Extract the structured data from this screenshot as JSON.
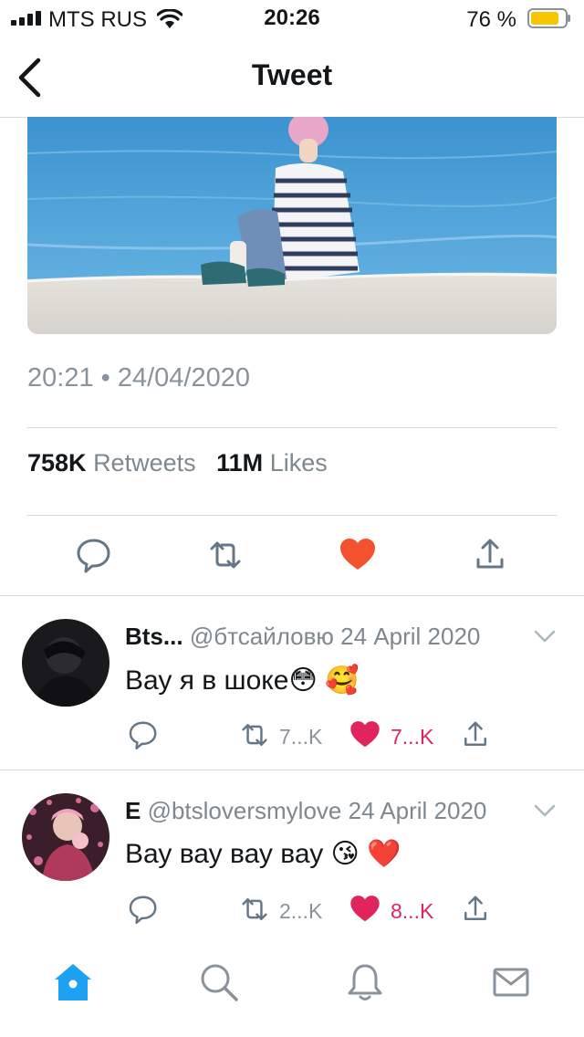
{
  "status_bar": {
    "carrier": "MTS RUS",
    "time": "20:26",
    "battery_percent": "76 %"
  },
  "header": {
    "title": "Tweet"
  },
  "tweet": {
    "timestamp": "20:21 • 24/04/2020",
    "retweet_count": "758K",
    "retweet_label": "Retweets",
    "like_count": "11M",
    "like_label": "Likes"
  },
  "replies": [
    {
      "name": "Bts...",
      "handle": "@бтсайловю",
      "date": "24 April 2020",
      "text": "Вау я в шоке😳 🥰",
      "retweets": "7...K",
      "likes": "7...K"
    },
    {
      "name": "E",
      "handle": "@btsloversmylove",
      "date": "24 April 2020",
      "text": "Вау вау вау вау 😘 ❤️",
      "retweets": "2...K",
      "likes": "8...K"
    }
  ],
  "tabs": [
    "home",
    "search",
    "notifications",
    "messages"
  ],
  "colors": {
    "accent": "#1da1f2",
    "like": "#e0245e",
    "muted": "#8a939b",
    "divider": "#d6d9db"
  }
}
